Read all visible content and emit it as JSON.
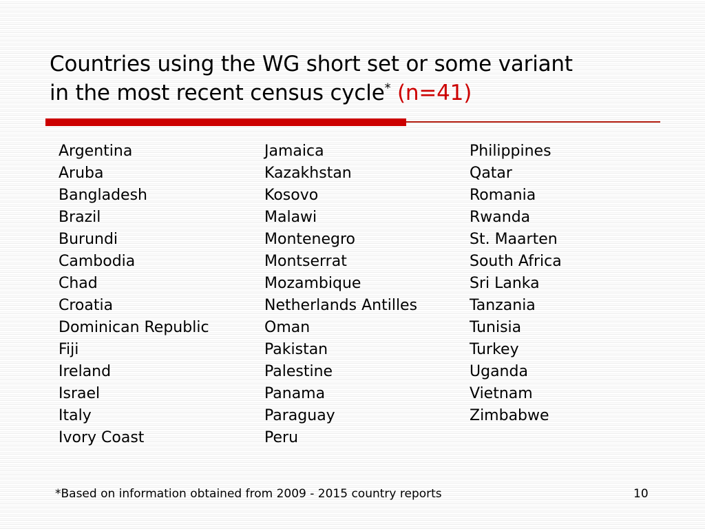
{
  "slide": {
    "title": {
      "line1": "Countries using the WG short set or some variant",
      "line2_main": "in the most recent census cycle",
      "line2_superscript": "*",
      "line2_count": "(n=41)"
    },
    "accent_color": "#cc0000",
    "divider_line_color": "#b01a0c",
    "text_color": "#000000",
    "background_color": "#ffffff"
  },
  "columns": [
    {
      "items": [
        "Argentina",
        "Aruba",
        "Bangladesh",
        "Brazil",
        "Burundi",
        "Cambodia",
        "Chad",
        "Croatia",
        "Dominican Republic",
        "Fiji",
        "Ireland",
        "Israel",
        "Italy",
        "Ivory Coast"
      ]
    },
    {
      "items": [
        "Jamaica",
        "Kazakhstan",
        "Kosovo",
        "Malawi",
        "Montenegro",
        "Montserrat",
        "Mozambique",
        "Netherlands Antilles",
        "Oman",
        "Pakistan",
        "Palestine",
        "Panama",
        "Paraguay",
        "Peru"
      ]
    },
    {
      "items": [
        "Philippines",
        "Qatar",
        "Romania",
        "Rwanda",
        "St. Maarten",
        "South Africa",
        "Sri Lanka",
        "Tanzania",
        "Tunisia",
        "Turkey",
        "Uganda",
        "Vietnam",
        "Zimbabwe"
      ]
    }
  ],
  "footer": {
    "footnote": "*Based on information obtained from 2009 - 2015 country reports",
    "page_number": "10"
  }
}
